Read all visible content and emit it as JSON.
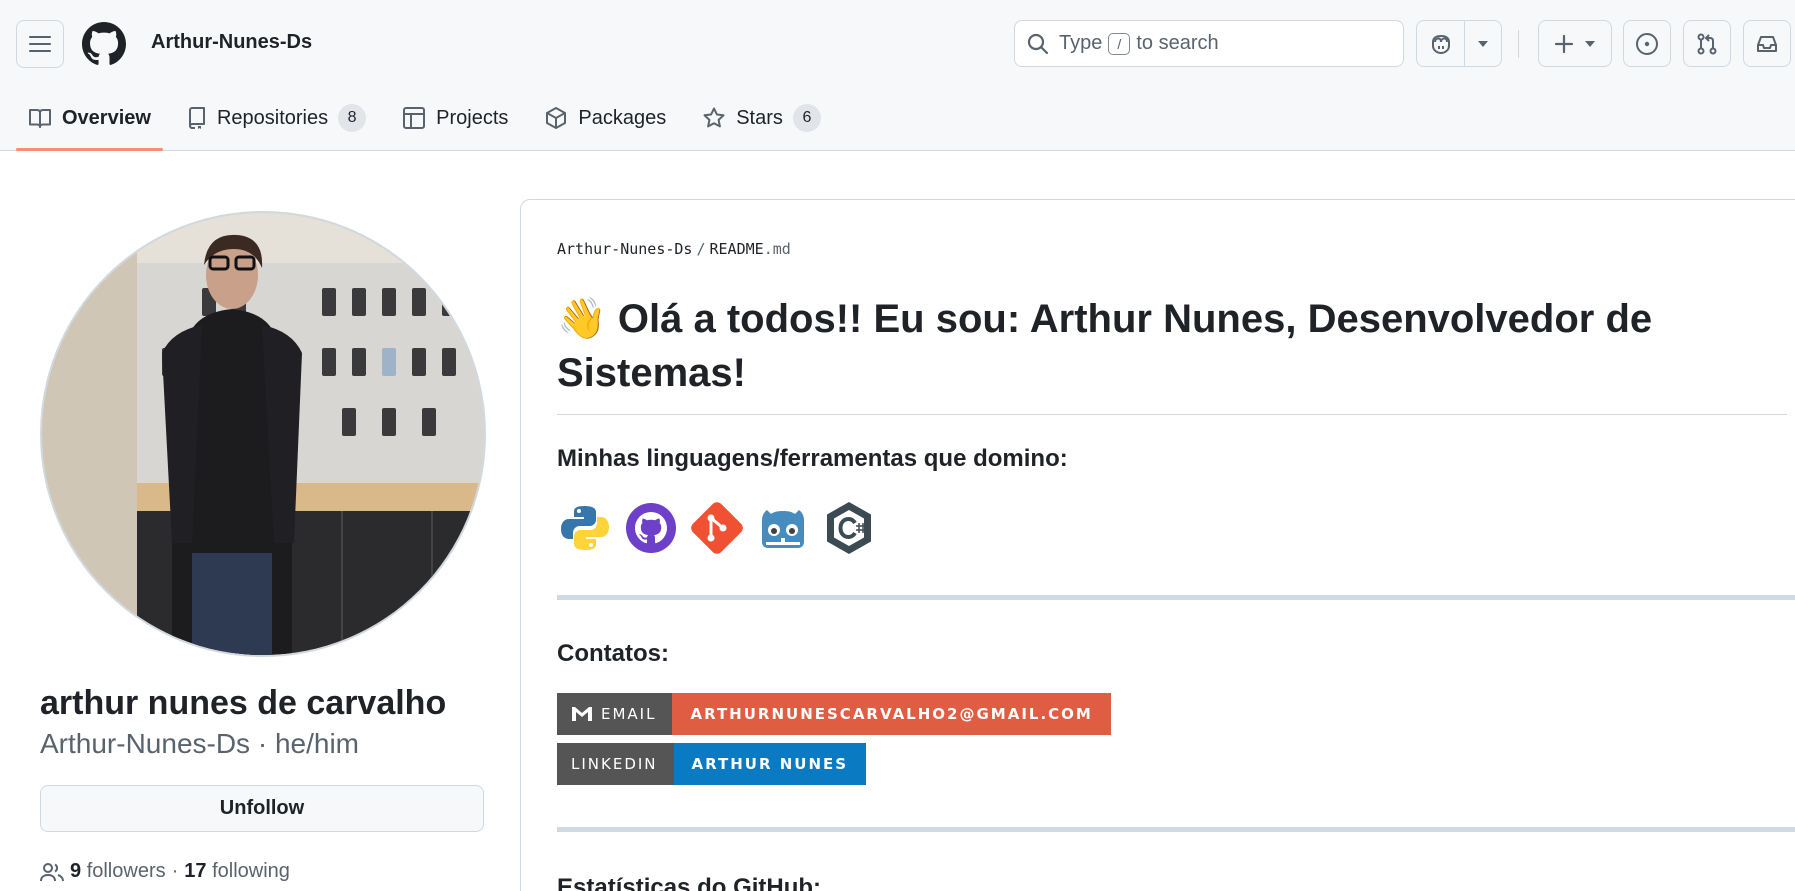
{
  "header": {
    "user_context": "Arthur-Nunes-Ds",
    "search": {
      "prefix": "Type",
      "key": "/",
      "suffix": "to search"
    }
  },
  "tabs": [
    {
      "label": "Overview",
      "icon": "book-icon",
      "selected": true
    },
    {
      "label": "Repositories",
      "icon": "repo-icon",
      "count": "8"
    },
    {
      "label": "Projects",
      "icon": "table-icon"
    },
    {
      "label": "Packages",
      "icon": "package-icon"
    },
    {
      "label": "Stars",
      "icon": "star-icon",
      "count": "6"
    }
  ],
  "profile": {
    "full_name": "arthur nunes de carvalho",
    "username": "Arthur-Nunes-Ds",
    "pronouns_sep": " · ",
    "pronouns": "he/him",
    "unfollow_label": "Unfollow",
    "followers_count": "9",
    "followers_label": "followers",
    "dot": "·",
    "following_count": "17",
    "following_label": "following"
  },
  "readme": {
    "path_owner": "Arthur-Nunes-Ds",
    "path_sep": "/",
    "path_file": "README",
    "path_ext": ".md",
    "title": "👋 Olá a todos!! Eu sou: Arthur Nunes, Desenvolvedor de Sistemas!",
    "languages_heading": "Minhas linguagens/ferramentas que domino:",
    "tools": [
      "python-icon",
      "github-icon",
      "git-icon",
      "godot-icon",
      "csharp-icon"
    ],
    "contacts_heading": "Contatos:",
    "email_badge": {
      "label": "EMAIL",
      "value": "ARTHURNUNESCARVALHO2@GMAIL.COM",
      "color": "#e05d44"
    },
    "linkedin_badge": {
      "label": "LINKEDIN",
      "value": "ARTHUR NUNES",
      "color": "#0a7ac2"
    },
    "stats_heading": "Estatísticas do GitHub:"
  },
  "colors": {
    "tab_underline": "#fd8c73",
    "border": "#d1d9e0",
    "muted_text": "#59636e"
  }
}
